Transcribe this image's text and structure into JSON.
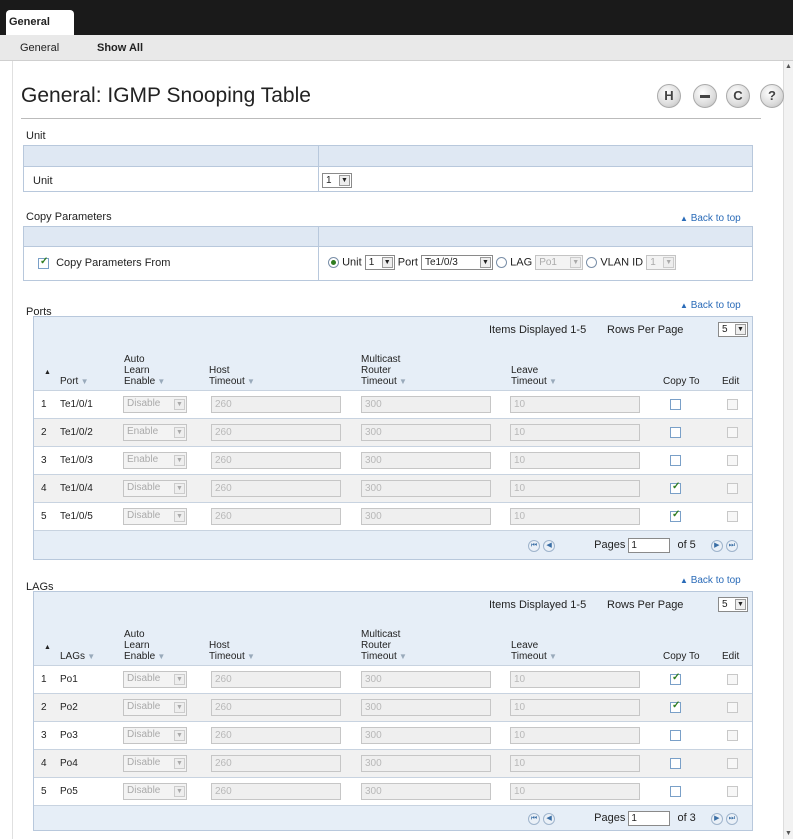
{
  "top_tab": "General",
  "subnav": {
    "general": "General",
    "show_all": "Show All"
  },
  "page_title": "General: IGMP Snooping Table",
  "toolbar": {
    "save": "H",
    "print": "▬",
    "refresh": "C",
    "help": "?"
  },
  "unit_section": {
    "title": "Unit",
    "label": "Unit",
    "value": "1"
  },
  "copy_section": {
    "title": "Copy Parameters",
    "back_to_top": "Back to top",
    "checkbox_label": "Copy Parameters From",
    "unit_label": "Unit",
    "unit_value": "1",
    "port_label": "Port",
    "port_value": "Te1/0/3",
    "lag_label": "LAG",
    "lag_value": "Po1",
    "vlan_label": "VLAN ID",
    "vlan_value": "1"
  },
  "ports": {
    "title": "Ports",
    "back_to_top": "Back to top",
    "items_displayed": "Items Displayed 1-5",
    "rows_per_page_label": "Rows Per Page",
    "rows_per_page": "5",
    "headers": {
      "first": "Port",
      "auto": [
        "Auto",
        "Learn",
        "Enable"
      ],
      "host": [
        "Host",
        "Timeout"
      ],
      "mrouter": [
        "Multicast",
        "Router",
        "Timeout"
      ],
      "leave": [
        "Leave",
        "Timeout"
      ],
      "copy": "Copy To",
      "edit": "Edit"
    },
    "rows": [
      {
        "n": "1",
        "name": "Te1/0/1",
        "auto": "Disable",
        "host": "260",
        "mrouter": "300",
        "leave": "10",
        "copy": false
      },
      {
        "n": "2",
        "name": "Te1/0/2",
        "auto": "Enable",
        "host": "260",
        "mrouter": "300",
        "leave": "10",
        "copy": false
      },
      {
        "n": "3",
        "name": "Te1/0/3",
        "auto": "Enable",
        "host": "260",
        "mrouter": "300",
        "leave": "10",
        "copy": false
      },
      {
        "n": "4",
        "name": "Te1/0/4",
        "auto": "Disable",
        "host": "260",
        "mrouter": "300",
        "leave": "10",
        "copy": true
      },
      {
        "n": "5",
        "name": "Te1/0/5",
        "auto": "Disable",
        "host": "260",
        "mrouter": "300",
        "leave": "10",
        "copy": true
      }
    ],
    "pages_label": "Pages",
    "page": "1",
    "of": "of 5"
  },
  "lags": {
    "title": "LAGs",
    "back_to_top": "Back to top",
    "items_displayed": "Items Displayed 1-5",
    "rows_per_page_label": "Rows Per Page",
    "rows_per_page": "5",
    "headers": {
      "first": "LAGs",
      "auto": [
        "Auto",
        "Learn",
        "Enable"
      ],
      "host": [
        "Host",
        "Timeout"
      ],
      "mrouter": [
        "Multicast",
        "Router",
        "Timeout"
      ],
      "leave": [
        "Leave",
        "Timeout"
      ],
      "copy": "Copy To",
      "edit": "Edit"
    },
    "rows": [
      {
        "n": "1",
        "name": "Po1",
        "auto": "Disable",
        "host": "260",
        "mrouter": "300",
        "leave": "10",
        "copy": true
      },
      {
        "n": "2",
        "name": "Po2",
        "auto": "Disable",
        "host": "260",
        "mrouter": "300",
        "leave": "10",
        "copy": true
      },
      {
        "n": "3",
        "name": "Po3",
        "auto": "Disable",
        "host": "260",
        "mrouter": "300",
        "leave": "10",
        "copy": false
      },
      {
        "n": "4",
        "name": "Po4",
        "auto": "Disable",
        "host": "260",
        "mrouter": "300",
        "leave": "10",
        "copy": false
      },
      {
        "n": "5",
        "name": "Po5",
        "auto": "Disable",
        "host": "260",
        "mrouter": "300",
        "leave": "10",
        "copy": false
      }
    ],
    "pages_label": "Pages",
    "page": "1",
    "of": "of 3"
  },
  "colors": {
    "accent": "#2a6bb8",
    "band": "#dfe8f3",
    "check": "#2f7d20"
  }
}
